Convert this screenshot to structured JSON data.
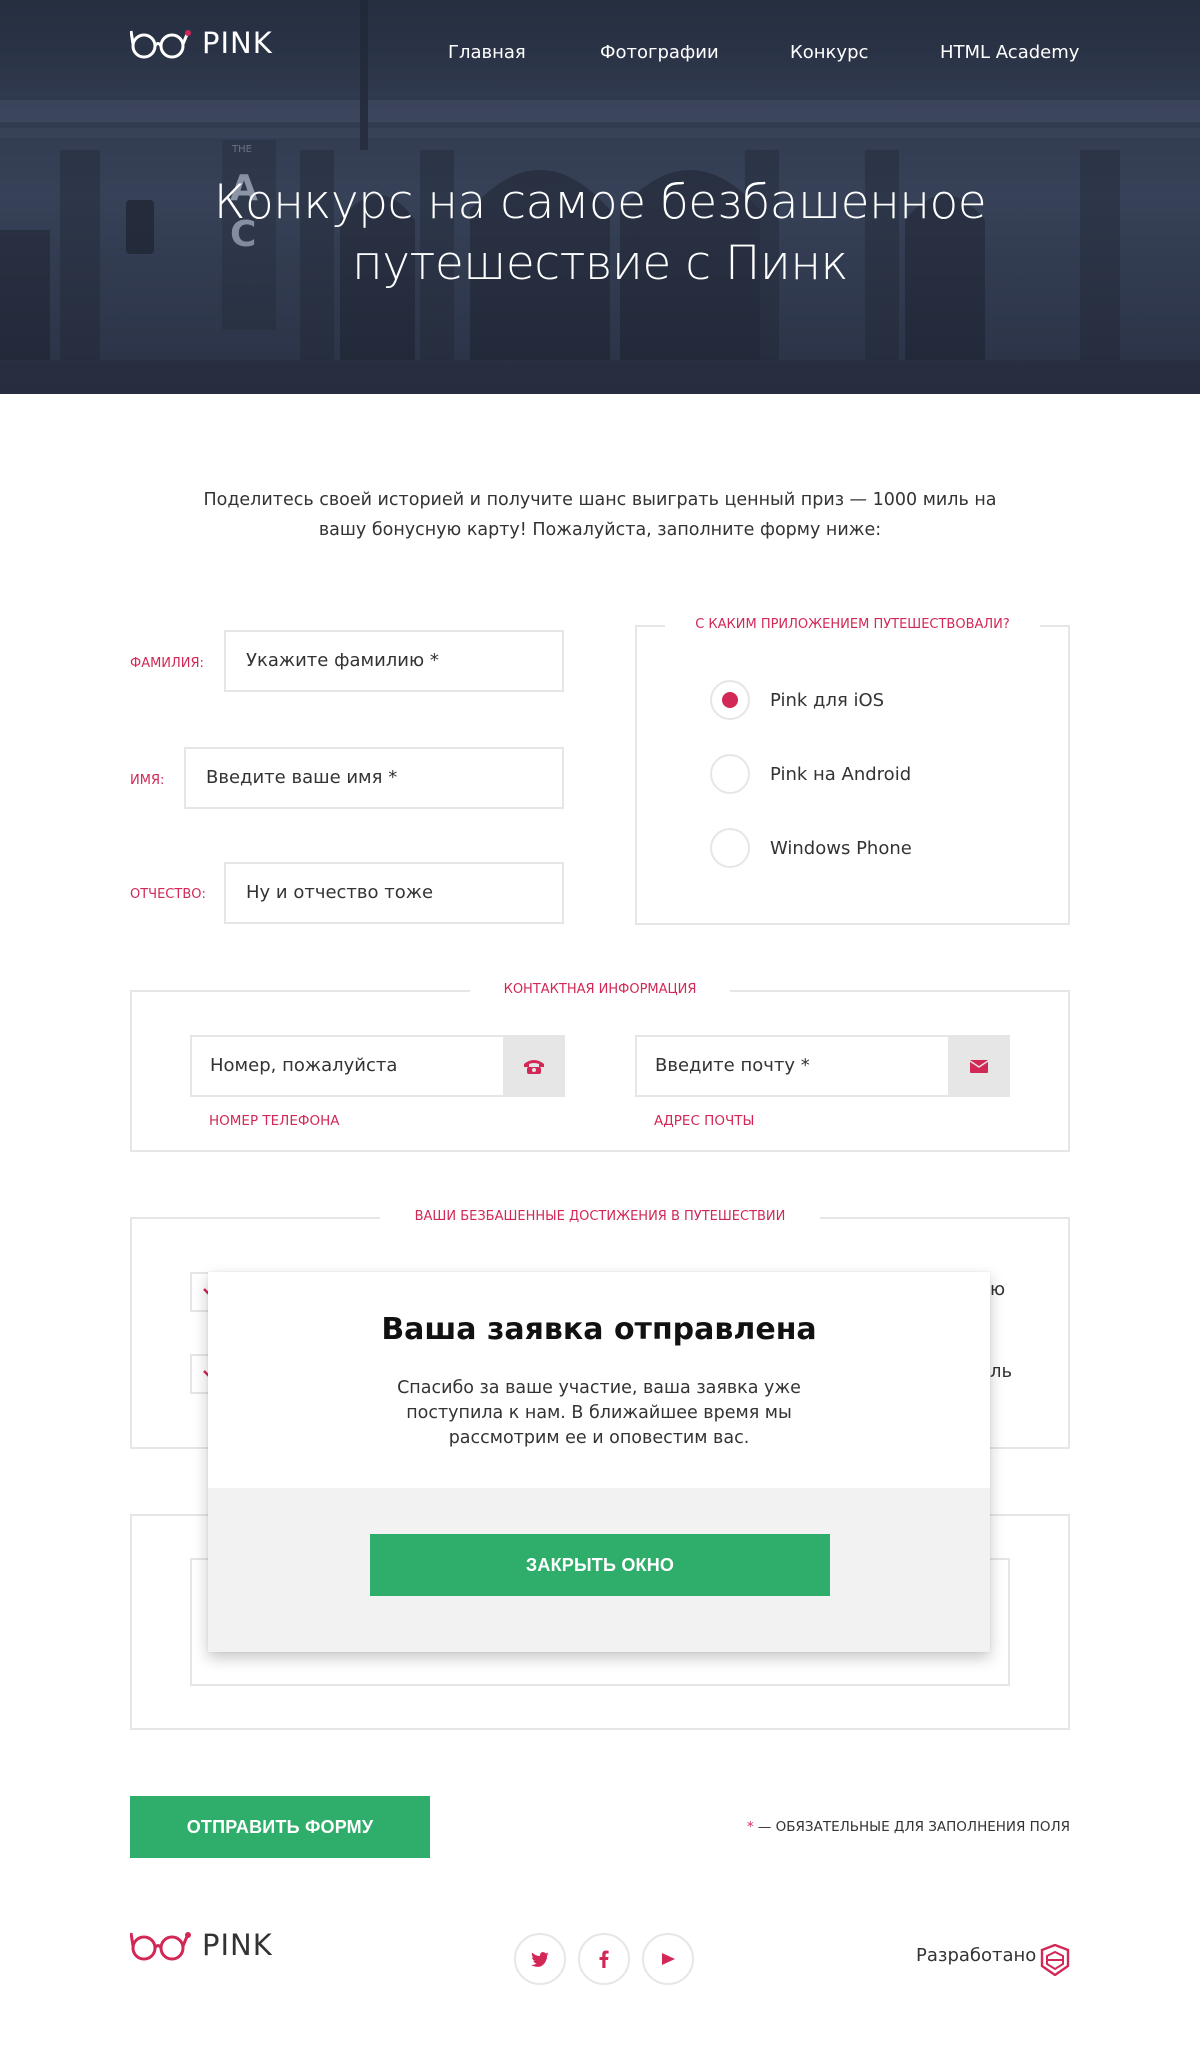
{
  "colors": {
    "accent": "#d22856",
    "green": "#2fae6b",
    "border": "#e6e6e6",
    "hero_overlay": "#2c3446"
  },
  "header": {
    "logo_text": "PINK",
    "nav": [
      {
        "label": "Главная"
      },
      {
        "label": "Фотографии"
      },
      {
        "label": "Конкурс"
      },
      {
        "label": "HTML Academy"
      }
    ],
    "title_line1": "Конкурс на самое безбашенное",
    "title_line2": "путешествие с Пинк"
  },
  "intro": {
    "line1": "Поделитесь своей историей и получите шанс выиграть ценный приз — 1000 миль на",
    "line2": "вашу бонусную карту! Пожалуйста, заполните форму ниже:"
  },
  "form": {
    "surname_label": "фамилия:",
    "surname_placeholder": "Укажите фамилию *",
    "name_label": "имя:",
    "name_placeholder": "Введите ваше имя *",
    "patronymic_label": "отчество:",
    "patronymic_placeholder": "Ну и отчество тоже",
    "app_legend": "С каким приложением путешествовали?",
    "apps": [
      {
        "label": "Pink для iOS",
        "checked": true
      },
      {
        "label": "Pink на Android",
        "checked": false
      },
      {
        "label": "Windows Phone",
        "checked": false
      }
    ],
    "contact_legend": "Контактная информация",
    "phone_placeholder": "Номер, пожалуйста",
    "phone_label": "номер телефона",
    "email_placeholder": "Введите почту *",
    "email_label": "адрес почты",
    "achievements_legend": "Ваши безбашенные достижения в путешествии",
    "partial_text_1": "ю",
    "partial_text_2": "ль",
    "submit_label": "Отправить форму",
    "required_star": "*",
    "required_note": " — обязательные для заполнения поля"
  },
  "modal": {
    "title": "Ваша заявка отправлена",
    "text_line1": "Спасибо за ваше участие, ваша заявка уже",
    "text_line2": "поступила к нам. В ближайшее время мы",
    "text_line3": "рассмотрим ее и оповестим вас.",
    "close_label": "Закрыть окно"
  },
  "footer": {
    "logo_text": "PINK",
    "social": [
      {
        "icon": "twitter-icon"
      },
      {
        "icon": "facebook-icon"
      },
      {
        "icon": "youtube-icon"
      }
    ],
    "made_by": "Разработано"
  }
}
